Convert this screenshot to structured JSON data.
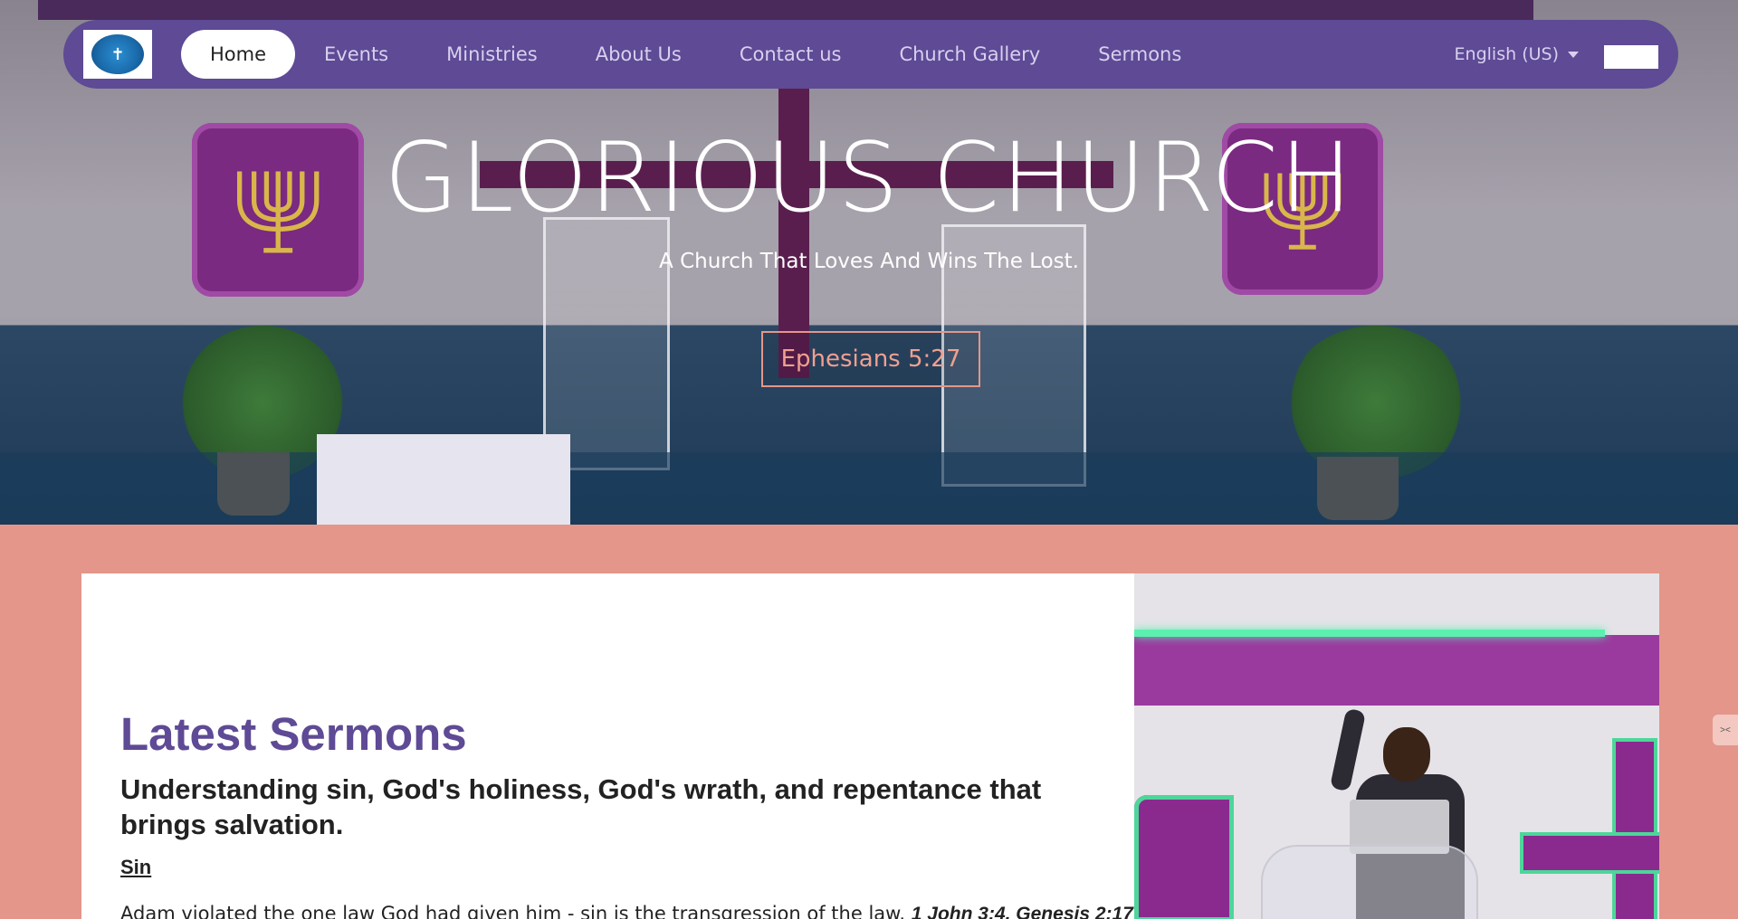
{
  "nav": {
    "logo_alt": "church logo",
    "items": [
      {
        "label": "Home",
        "active": true
      },
      {
        "label": "Events"
      },
      {
        "label": "Ministries"
      },
      {
        "label": "About Us"
      },
      {
        "label": "Contact us"
      },
      {
        "label": "Church Gallery"
      },
      {
        "label": "Sermons"
      }
    ],
    "language": "English (US)"
  },
  "hero": {
    "title": "GLORIOUS CHURCH",
    "subtitle": "A Church That Loves And Wins The Lost.",
    "verse_button": "Ephesians 5:27"
  },
  "sermons": {
    "section_title": "Latest Sermons",
    "headline": "Understanding sin, God's holiness, God's wrath, and  repentance that brings salvation.",
    "subheading": "Sin",
    "body_text": "Adam violated the one law God had given him - sin is the transgression of the law.",
    "body_refs": "1 John 3:4, Genesis 2:17"
  },
  "colors": {
    "nav_bg": "#5e4a95",
    "accent": "#e4968a",
    "title_purple": "#5e4a95"
  }
}
